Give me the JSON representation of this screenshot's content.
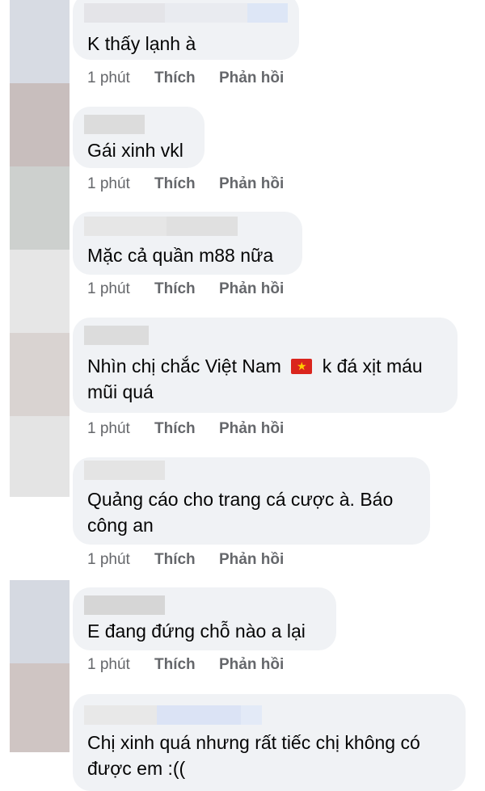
{
  "comments": [
    {
      "text": "K thấy lạnh à",
      "time": "1 phút",
      "like": "Thích",
      "reply": "Phản hồi"
    },
    {
      "text": "Gái xinh vkl",
      "time": "1 phút",
      "like": "Thích",
      "reply": "Phản hồi"
    },
    {
      "text": "Mặc cả quần m88 nữa",
      "time": "1 phút",
      "like": "Thích",
      "reply": "Phản hồi"
    },
    {
      "text_before_flag": "Nhìn chị chắc Việt Nam",
      "flag_icon": "vietnam-flag-icon",
      "text_after_flag": "k đá xịt máu mũi quá",
      "time": "1 phút",
      "like": "Thích",
      "reply": "Phản hồi"
    },
    {
      "text": "Quảng cáo cho trang cá cược à. Báo công an",
      "time": "1 phút",
      "like": "Thích",
      "reply": "Phản hồi"
    },
    {
      "text": "E đang đứng chỗ nào a lại",
      "time": "1 phút",
      "like": "Thích",
      "reply": "Phản hồi"
    },
    {
      "text": "Chị xinh quá nhưng rất tiếc chị không có được em :((",
      "time": "",
      "like": "",
      "reply": ""
    }
  ],
  "colors": {
    "bubble": "#f0f2f5",
    "meta_text": "#65676b",
    "flag_red": "#da251d",
    "flag_star": "#ffcd00"
  }
}
